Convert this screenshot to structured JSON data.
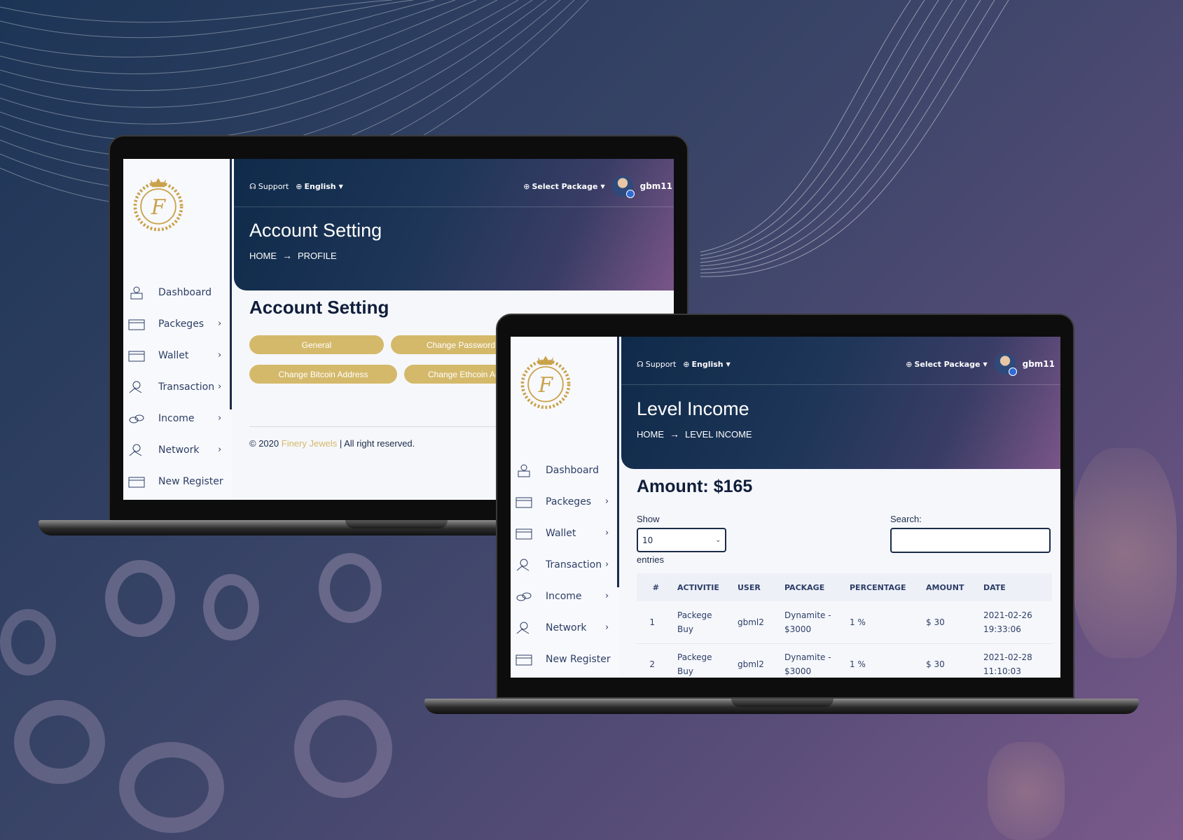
{
  "colors": {
    "accent_gold": "#d4b96b",
    "header_dark": "#0f2a4a",
    "header_purple": "#7a5588",
    "text_navy": "#2c3e66"
  },
  "topbar": {
    "support": "Support",
    "language": "English",
    "select_package": "Select Package",
    "username": "gbm11"
  },
  "sidebar": {
    "items": [
      {
        "label": "Dashboard",
        "icon": "dashboard-user-icon",
        "has_chevron": false
      },
      {
        "label": "Packeges",
        "icon": "package-box-icon",
        "has_chevron": true
      },
      {
        "label": "Wallet",
        "icon": "wallet-box-icon",
        "has_chevron": true
      },
      {
        "label": "Transaction",
        "icon": "hand-coin-icon",
        "has_chevron": true
      },
      {
        "label": "Income",
        "icon": "coin-stack-icon",
        "has_chevron": true
      },
      {
        "label": "Network",
        "icon": "hand-coin-icon",
        "has_chevron": true
      },
      {
        "label": "New Register",
        "icon": "register-box-icon",
        "has_chevron": false
      }
    ]
  },
  "account_screen": {
    "title": "Account Setting",
    "breadcrumb_home": "HOME",
    "breadcrumb_current": "PROFILE",
    "section_title": "Account Setting",
    "tabs": [
      "General",
      "Change Password",
      "Change Bitcoin Address",
      "Change Ethcoin Address"
    ],
    "footer_prefix": "© 2020",
    "footer_brand": "Finery Jewels",
    "footer_suffix": "| All right reserved."
  },
  "income_screen": {
    "title": "Level Income",
    "breadcrumb_home": "HOME",
    "breadcrumb_current": "LEVEL INCOME",
    "amount": "Amount: $165",
    "show_label": "Show",
    "show_value": "10",
    "entries_label": "entries",
    "search_label": "Search:",
    "columns": [
      "#",
      "ACTIVITIE",
      "USER",
      "PACKAGE",
      "PERCENTAGE",
      "AMOUNT",
      "DATE"
    ],
    "rows": [
      {
        "n": "1",
        "activity": "Packege Buy",
        "user": "gbml2",
        "package": "Dynamite - $3000",
        "percentage": "1 %",
        "amount": "$ 30",
        "date": "2021-02-26 19:33:06"
      },
      {
        "n": "2",
        "activity": "Packege Buy",
        "user": "gbml2",
        "package": "Dynamite - $3000",
        "percentage": "1 %",
        "amount": "$ 30",
        "date": "2021-02-28 11:10:03"
      }
    ]
  }
}
